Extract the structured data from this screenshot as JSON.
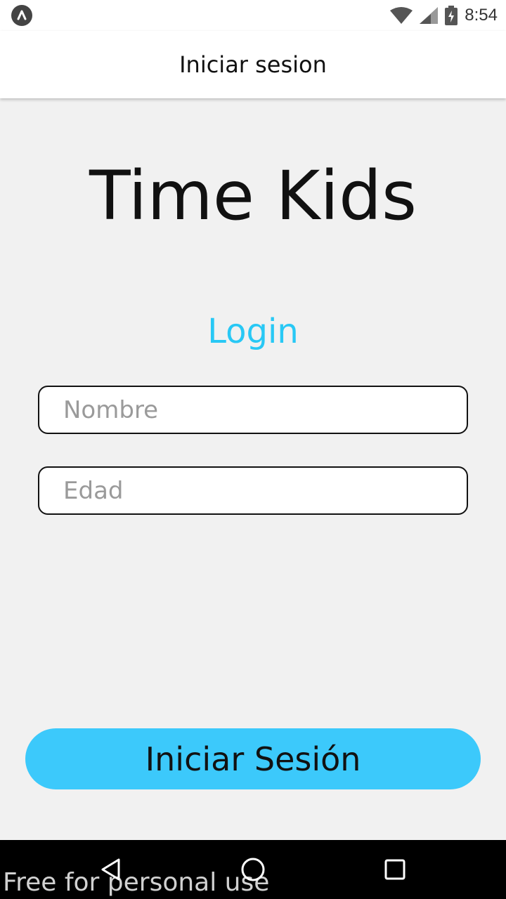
{
  "status_bar": {
    "time": "8:54",
    "icons": [
      "app-notification-icon",
      "wifi-icon",
      "signal-icon",
      "battery-charging-icon"
    ]
  },
  "header": {
    "title": "Iniciar sesion"
  },
  "main": {
    "app_title": "Time Kids",
    "login_heading": "Login",
    "name_field": {
      "placeholder": "Nombre",
      "value": ""
    },
    "age_field": {
      "placeholder": "Edad",
      "value": ""
    },
    "submit_label": "Iniciar Sesión"
  },
  "nav_bar": {
    "icons": [
      "back-icon",
      "home-icon",
      "recents-icon"
    ]
  },
  "watermark": "Free for personal use",
  "colors": {
    "accent": "#3cc9fb",
    "login_heading": "#28c8f5",
    "background": "#f1f1f1"
  }
}
